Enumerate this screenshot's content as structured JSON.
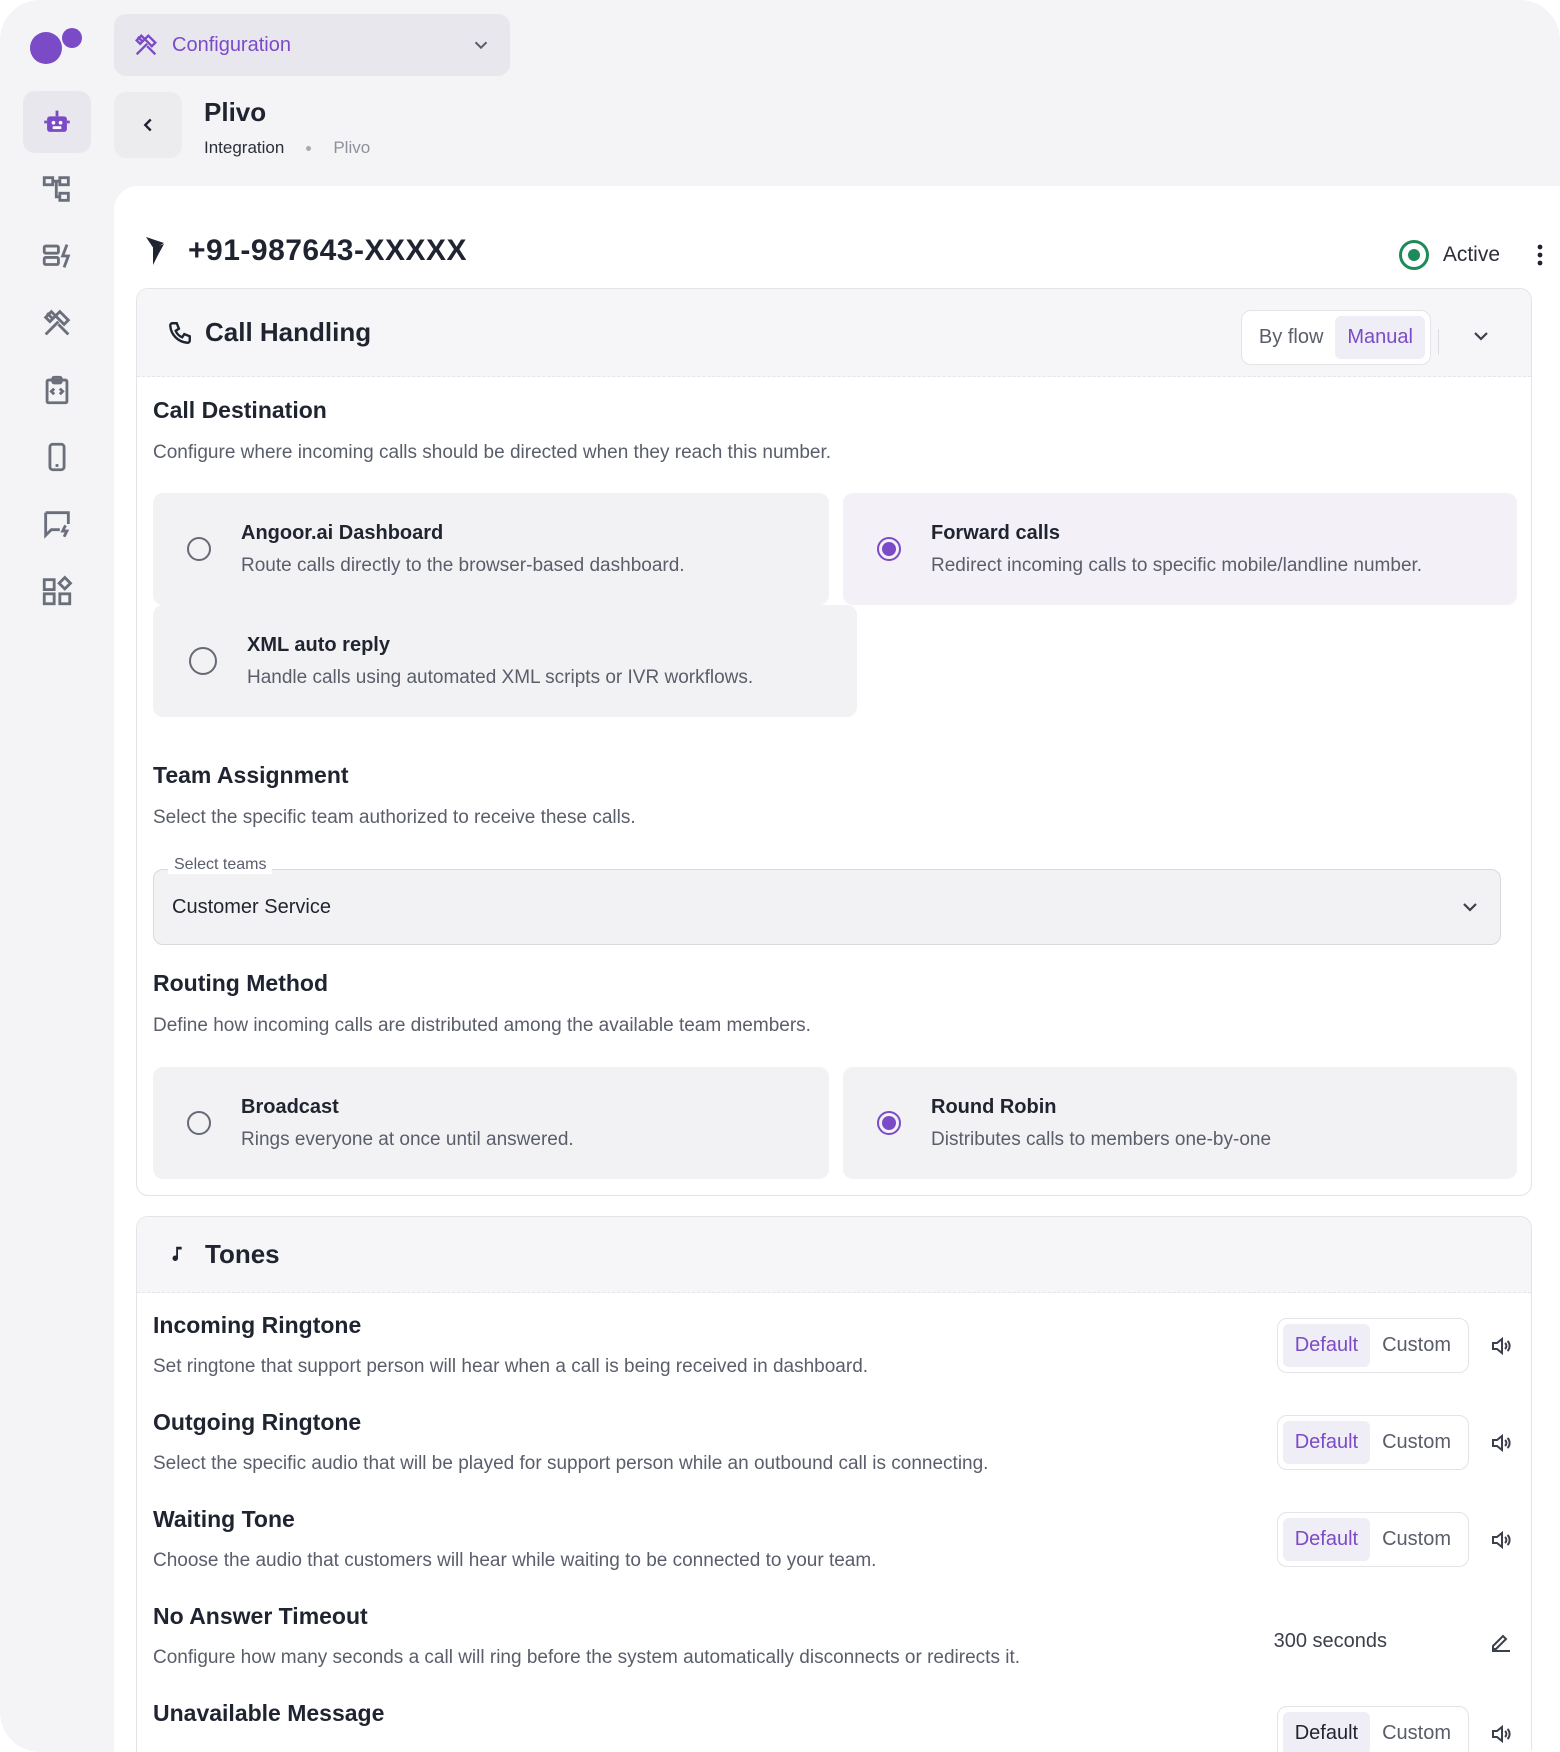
{
  "topbar": {
    "config_label": "Configuration"
  },
  "header": {
    "title": "Plivo",
    "breadcrumb": [
      "Integration",
      "Plivo"
    ]
  },
  "number": {
    "phone": "+91-987643-XXXXX",
    "status": "Active",
    "status_color": "#1e8a5a"
  },
  "call_handling": {
    "title": "Call Handling",
    "mode_options": [
      "By flow",
      "Manual"
    ],
    "mode_selected": "Manual",
    "destination": {
      "title": "Call Destination",
      "description": "Configure where incoming calls should be directed when they reach this number.",
      "options": [
        {
          "title": "Angoor.ai Dashboard",
          "description": "Route calls directly to the browser-based dashboard.",
          "selected": false
        },
        {
          "title": "Forward calls",
          "description": "Redirect incoming calls to specific mobile/landline number.",
          "selected": true
        },
        {
          "title": "XML auto reply",
          "description": "Handle calls using automated XML scripts or IVR workflows.",
          "selected": false
        }
      ]
    },
    "team": {
      "title": "Team Assignment",
      "description": "Select the specific team authorized to receive these calls.",
      "select_label": "Select teams",
      "select_value": "Customer Service"
    },
    "routing": {
      "title": "Routing Method",
      "description": "Define how incoming calls are distributed among the available team members.",
      "options": [
        {
          "title": "Broadcast",
          "description": "Rings everyone at once until answered.",
          "selected": false
        },
        {
          "title": "Round Robin",
          "description": "Distributes calls to members one-by-one",
          "selected": true
        }
      ]
    }
  },
  "tones": {
    "title": "Tones",
    "default_label": "Default",
    "custom_label": "Custom",
    "rows": [
      {
        "title": "Incoming Ringtone",
        "description": "Set ringtone that support person will hear when a call is being received in dashboard."
      },
      {
        "title": "Outgoing Ringtone",
        "description": "Select the specific audio that will be played for support person while an outbound call is connecting."
      },
      {
        "title": "Waiting Tone",
        "description": "Choose the audio that customers will hear while waiting to be connected to your team."
      },
      {
        "title": "No Answer Timeout",
        "description": "Configure how many seconds a call will ring before the system automatically disconnects or redirects it.",
        "value": "300 seconds"
      },
      {
        "title": "Unavailable Message",
        "description": ""
      }
    ]
  },
  "colors": {
    "accent": "#7b4bc7",
    "page_bg": "#f4f4f6",
    "card_bg": "#f2f2f4"
  },
  "icons": {
    "sidebar": [
      "robot-icon",
      "flow-icon",
      "storage-bolt-icon",
      "tools-icon",
      "code-clipboard-icon",
      "mobile-icon",
      "chat-bolt-icon",
      "widgets-icon"
    ]
  }
}
